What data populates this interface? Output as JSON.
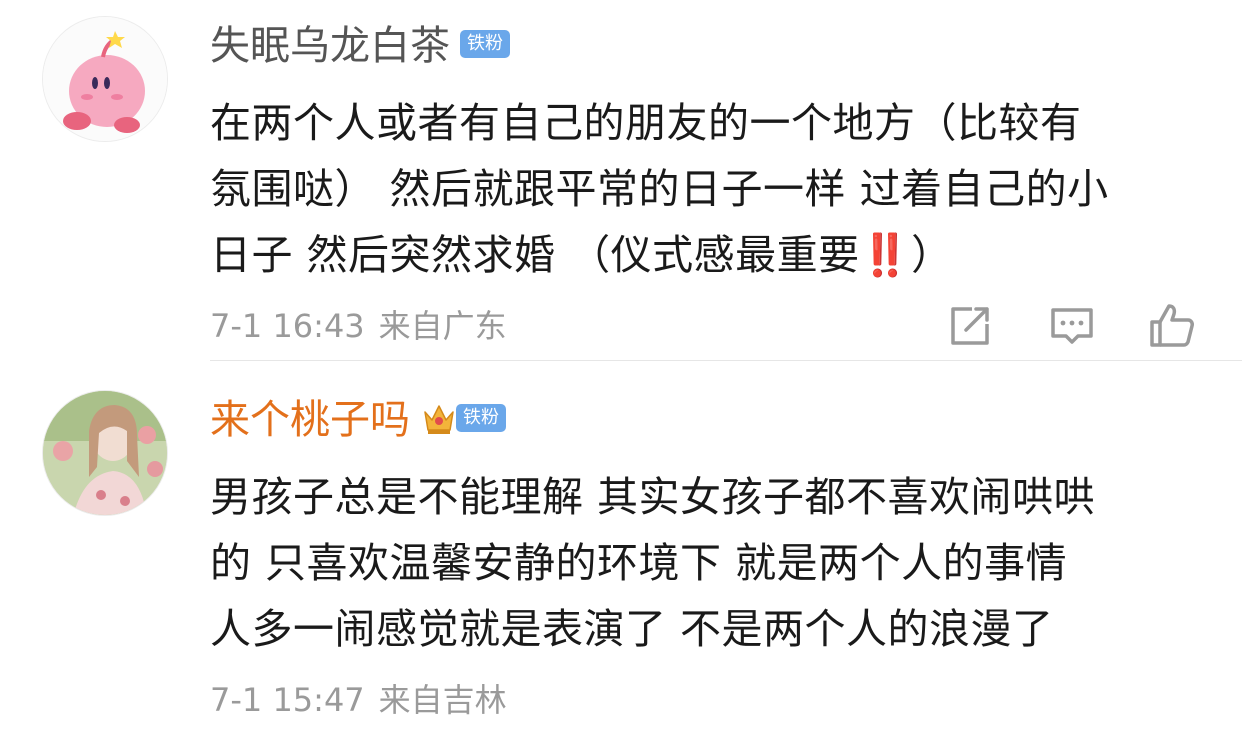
{
  "comments": [
    {
      "username": "失眠乌龙白茶",
      "badge": "铁粉",
      "text_before": "在两个人或者有自己的朋友的一个地方（比较有\n氛围哒） 然后就跟平常的日子一样 过着自己的小\n日子 然后突然求婚 （仪式感最重要",
      "emoji": "‼️",
      "text_after": "）",
      "time": "7-1 16:43",
      "location": "来自广东",
      "actions": [
        "share-icon",
        "comment-icon",
        "like-icon"
      ]
    },
    {
      "username": "来个桃子吗",
      "badge": "铁粉",
      "crown_icon": "crown-icon",
      "text": "男孩子总是不能理解 其实女孩子都不喜欢闹哄哄\n的 只喜欢温馨安静的环境下 就是两个人的事情\n人多一闹感觉就是表演了 不是两个人的浪漫了",
      "time": "7-1 15:47",
      "location": "来自吉林"
    }
  ],
  "colors": {
    "username_default": "#555555",
    "username_vip": "#e3701b",
    "badge_bg": "#6aa7ea",
    "meta": "#9a9a9a",
    "text": "#1a1a1a"
  }
}
